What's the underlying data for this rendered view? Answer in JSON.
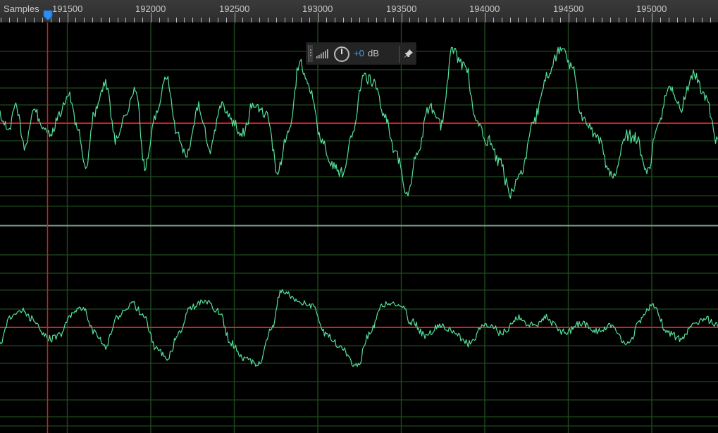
{
  "ruler": {
    "unit_label": "Samples",
    "labels": [
      "191500",
      "192000",
      "192500",
      "193000",
      "193500",
      "194000",
      "194500",
      "195000"
    ]
  },
  "hud": {
    "gain_value": "+0",
    "gain_unit": "dB",
    "icons": {
      "grip": "drag-grip-icon",
      "meter": "level-meter-icon",
      "knob": "volume-knob-icon",
      "pin": "pin-icon"
    }
  },
  "colors": {
    "waveform": "#55e09a",
    "center_line": "#d42020",
    "cursor": "#d42020",
    "grid": "#1e4a1e",
    "divider": "#7f9f8a",
    "playhead_marker": "#2f8ff0",
    "hud_value": "#3ea0ff"
  }
}
